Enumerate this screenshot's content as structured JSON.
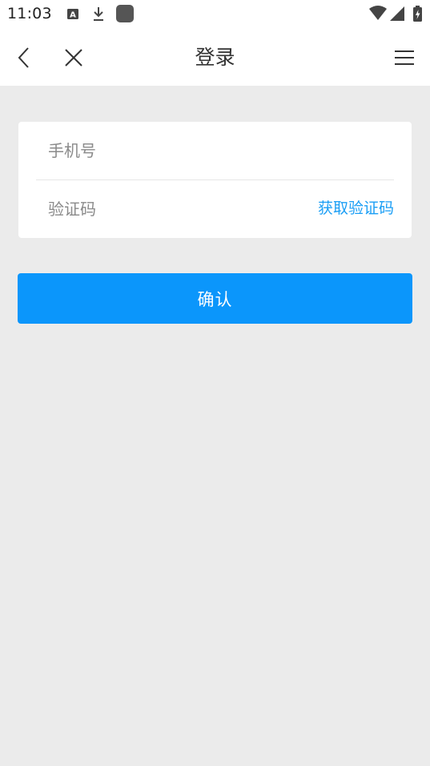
{
  "status_bar": {
    "time": "11:03",
    "icons": [
      "a-notification-icon",
      "download-icon",
      "square-app-icon",
      "wifi-icon",
      "signal-icon",
      "battery-charging-icon"
    ]
  },
  "header": {
    "back_icon": "chevron-left-icon",
    "close_icon": "close-icon",
    "title": "登录",
    "menu_icon": "hamburger-menu-icon"
  },
  "form": {
    "phone": {
      "placeholder": "手机号",
      "value": ""
    },
    "code": {
      "placeholder": "验证码",
      "value": ""
    },
    "get_code_label": "获取验证码"
  },
  "confirm_label": "确认",
  "colors": {
    "accent": "#0b96fb",
    "link": "#1a9ef5",
    "background": "#ebebeb"
  }
}
